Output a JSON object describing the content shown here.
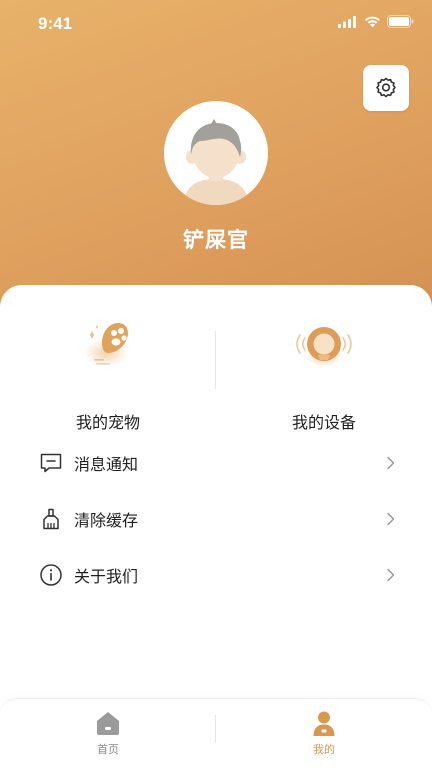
{
  "status_bar": {
    "time": "9:41"
  },
  "profile": {
    "nickname": "铲屎官"
  },
  "quick_actions": [
    {
      "label": "我的宠物",
      "icon": "pet-paw-icon"
    },
    {
      "label": "我的设备",
      "icon": "device-icon"
    }
  ],
  "menu": [
    {
      "label": "消息通知",
      "icon": "message-icon"
    },
    {
      "label": "清除缓存",
      "icon": "broom-icon"
    },
    {
      "label": "关于我们",
      "icon": "info-icon"
    }
  ],
  "tabbar": {
    "items": [
      {
        "label": "首页",
        "icon": "home-icon",
        "active": false
      },
      {
        "label": "我的",
        "icon": "user-icon",
        "active": true
      }
    ]
  },
  "colors": {
    "header_start": "#e8b26a",
    "header_end": "#d38f52",
    "accent": "#d9984f",
    "tab_inactive": "#8a8a8a"
  }
}
